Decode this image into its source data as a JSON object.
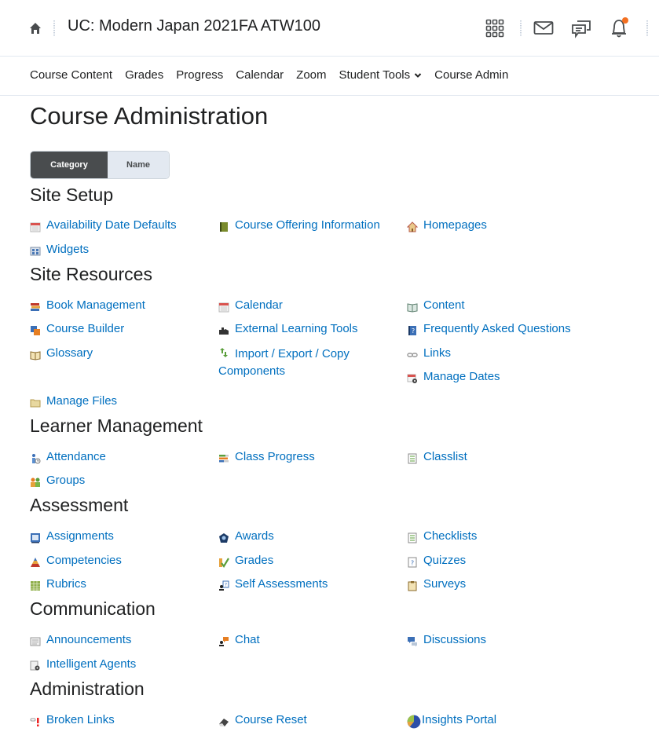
{
  "header": {
    "course_title": "UC: Modern Japan 2021FA ATW100",
    "icons": [
      "home-icon",
      "waffle-grid-icon",
      "mail-icon",
      "chat-bubbles-icon",
      "bell-icon"
    ],
    "notification_color": "#f37021"
  },
  "navbar": {
    "items": [
      {
        "label": "Course Content"
      },
      {
        "label": "Grades"
      },
      {
        "label": "Progress"
      },
      {
        "label": "Calendar"
      },
      {
        "label": "Zoom"
      },
      {
        "label": "Student Tools",
        "has_dropdown": true
      },
      {
        "label": "Course Admin"
      }
    ]
  },
  "page": {
    "title": "Course Administration",
    "view_toggle": {
      "category": "Category",
      "name": "Name",
      "selected": "Category"
    }
  },
  "sections": {
    "site_setup": {
      "title": "Site Setup",
      "tools": [
        "Availability Date Defaults",
        "Course Offering Information",
        "Homepages",
        "Widgets"
      ]
    },
    "site_resources": {
      "title": "Site Resources",
      "tools": [
        "Book Management",
        "Calendar",
        "Content",
        "Course Builder",
        "External Learning Tools",
        "Frequently Asked Questions",
        "Glossary",
        "Import / Export / Copy Components",
        "Links",
        "Manage Dates",
        "Manage Files"
      ]
    },
    "learner_management": {
      "title": "Learner Management",
      "tools": [
        "Attendance",
        "Class Progress",
        "Classlist",
        "Groups"
      ]
    },
    "assessment": {
      "title": "Assessment",
      "tools": [
        "Assignments",
        "Awards",
        "Checklists",
        "Competencies",
        "Grades",
        "Quizzes",
        "Rubrics",
        "Self Assessments",
        "Surveys"
      ]
    },
    "communication": {
      "title": "Communication",
      "tools": [
        "Announcements",
        "Chat",
        "Discussions",
        "Intelligent Agents"
      ]
    },
    "administration": {
      "title": "Administration",
      "tools": [
        "Broken Links",
        "Course Reset",
        "Insights Portal"
      ]
    }
  },
  "colors": {
    "link": "#006fbf",
    "text": "#202122",
    "toggle_active_bg": "#494c4e",
    "toggle_inactive_bg": "#e3e9f1"
  }
}
